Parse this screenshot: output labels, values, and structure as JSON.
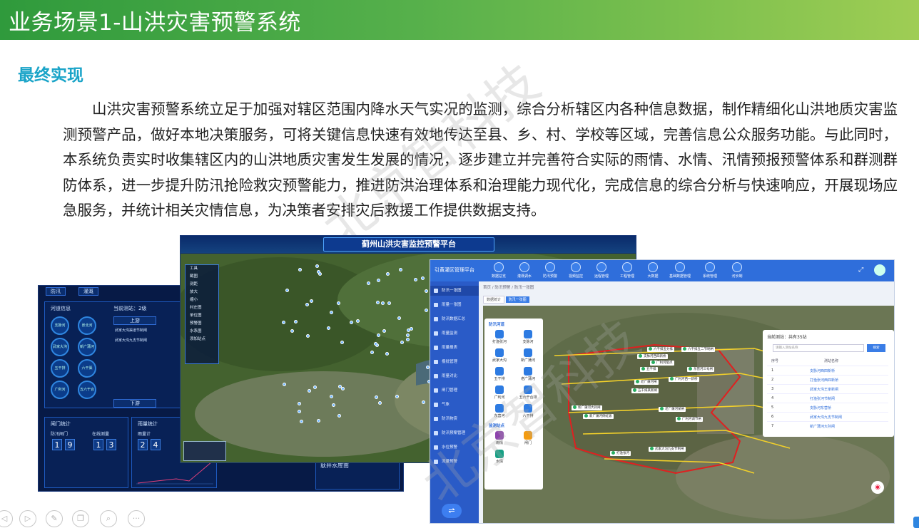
{
  "slide": {
    "title": "业务场景1-山洪灾害预警系统",
    "section_title": "最终实现",
    "body": "山洪灾害预警系统立足于加强对辖区范围内降水天气实况的监测，综合分析辖区内各种信息数据，制作精细化山洪地质灾害监测预警产品，做好本地决策服务，可将关键信息快速有效地传达至县、乡、村、学校等区域，完善信息公众服务功能。与此同时，本系统负责实时收集辖区内的山洪地质灾害发生发展的情况，逐步建立并完善符合实际的雨情、水情、汛情预报预警体系和群测群防体系，进一步提升防汛抢险救灾预警能力，推进防洪治理体系和治理能力现代化，完成信息的综合分析与快速响应，开展现场应急服务，并统计相关灾情信息，为决策者安排灾后救援工作提供数据支持。",
    "watermark": "北京智科技"
  },
  "shot1": {
    "tabs": [
      "防汛",
      "灌溉"
    ],
    "panel_river": "河道信息",
    "current_station": "当前测站：2级",
    "btn_up": "上游",
    "btn_down": "下游",
    "station_a": "武家大沟渠道节制闸",
    "station_b": "武家大沟九支节制闸",
    "circles": [
      "支脉河",
      "张北河",
      "武家大沟",
      "新广蒲河",
      "五干排",
      "六干渠",
      "广利河",
      "五六干合排",
      "东营河",
      "小清河"
    ],
    "gate_stats": "闸门统计",
    "rain_stats": "雨量统计",
    "gate_label": "防汛闸门",
    "online_label": "在线测量",
    "rain_label": "雨量计",
    "gate_digits": [
      "1",
      "9"
    ],
    "online_digits": [
      "1",
      "3"
    ],
    "rain_digits": [
      "2",
      "4"
    ],
    "reservoir": "耿井水库南"
  },
  "shot2": {
    "title": "蓟州山洪灾害监控预警平台",
    "tools": [
      "工具",
      "截图",
      "测距",
      "放大",
      "缩小",
      "村庄图",
      "单位图",
      "预警图",
      "水系图",
      "添加站点"
    ]
  },
  "shot3": {
    "title": "引黄灌区管理平台",
    "nav": [
      "数据总览",
      "灌溉调水",
      "防汛预警",
      "视频监控",
      "远程管理",
      "工程管理",
      "大数据",
      "基础数据管理",
      "系统管理",
      "河长制"
    ],
    "side": [
      "防汛一张图",
      "雨量一张图",
      "防汛数据汇总",
      "雨量监测",
      "雨量报表",
      "报批管理",
      "雨量对比",
      "闸门管理",
      "气象",
      "防汛物资",
      "防汛预案管理",
      "水位预警",
      "流量预警"
    ],
    "crumbs": "首页 / 防汛预警 / 防汛一张图",
    "subtabs": [
      "数据统计",
      "防汛一张图"
    ],
    "legend_head1": "防汛河道",
    "legend_head2": "监测站点",
    "legend_items": [
      "打渔张河",
      "支脉河",
      "武家大沟",
      "新广蒲河",
      "五干排",
      "老广蒲河",
      "广利河",
      "五六干合排",
      "东营河",
      "六干排"
    ],
    "station_items": [
      "雨情",
      "闸门",
      "水情"
    ],
    "table_title": "当前测站：共有35站",
    "search_placeholder": "请输入测站名称",
    "search_btn": "搜索",
    "col_no": "序号",
    "col_name": "测站名称",
    "rows": [
      {
        "no": "1",
        "name": "支脉河西四新桥"
      },
      {
        "no": "2",
        "name": "打渔张河西四新桥"
      },
      {
        "no": "3",
        "name": "武家大沟王家新闸"
      },
      {
        "no": "4",
        "name": "打渔张河节制闸"
      },
      {
        "no": "5",
        "name": "支脉河东营桥"
      },
      {
        "no": "6",
        "name": "武家大沟九支节制闸"
      },
      {
        "no": "7",
        "name": "新广蒲河大孙闸"
      }
    ],
    "markers": [
      "六干排五分排",
      "六干排五二节制闸",
      "支脉河西四新桥",
      "五干排",
      "广利河阻点",
      "东营河三号闸",
      "老广蒲河闸",
      "广利河西一新桥",
      "五干排某新闸",
      "新广蒲河大孙闸",
      "老广蒲河某闸",
      "新广蒲河倒虹吸",
      "广利河调节闸",
      "打渔张河",
      "武家大沟九支节制闸"
    ]
  },
  "bottom": {
    "icons": [
      "left-arrow-icon",
      "right-arrow-icon",
      "pen-icon",
      "copy-icon",
      "search-icon",
      "more-icon"
    ]
  }
}
